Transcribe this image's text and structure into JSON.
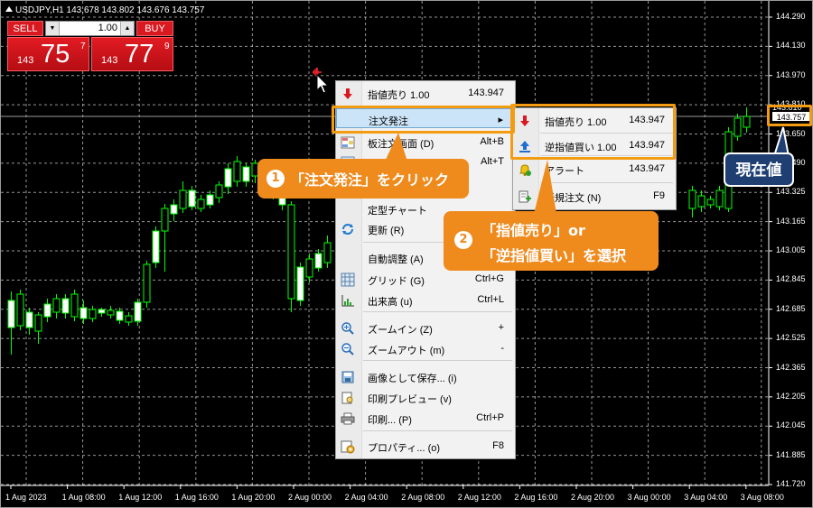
{
  "chart": {
    "symbol_info": "USDJPY,H1  143.678 143.802 143.676 143.757",
    "current_price_hidden": "143.810",
    "current_price": "143.757",
    "y_axis_labels": [
      "144.290",
      "144.130",
      "143.970",
      "143.810",
      "143.650",
      "143.490",
      "143.325",
      "143.165",
      "143.005",
      "142.845",
      "142.685",
      "142.525",
      "142.365",
      "142.205",
      "142.045",
      "141.885",
      "141.720"
    ],
    "x_axis_labels": [
      "1 Aug 2023",
      "1 Aug 08:00",
      "1 Aug 12:00",
      "1 Aug 16:00",
      "1 Aug 20:00",
      "2 Aug 00:00",
      "2 Aug 04:00",
      "2 Aug 08:00",
      "2 Aug 12:00",
      "2 Aug 16:00",
      "2 Aug 20:00",
      "3 Aug 00:00",
      "3 Aug 04:00",
      "3 Aug 08:00"
    ],
    "colors": {
      "background": "#000000",
      "bull_candle": "#ffffff",
      "bear_candle": "#000000",
      "wick": "#00ff00",
      "grid": "#c8c8c8"
    }
  },
  "one_click": {
    "sell_label": "SELL",
    "buy_label": "BUY",
    "lot": "1.00",
    "down_arrow": "▼",
    "up_arrow": "▲",
    "bid_prefix": "143",
    "bid_big": "75",
    "bid_sup": "7",
    "ask_prefix": "143",
    "ask_big": "77",
    "ask_sup": "9"
  },
  "context_menu": {
    "items": [
      {
        "label": "指値売り 1.00",
        "shortcut": "143.947",
        "icon": "sell-limit-arrow-icon"
      },
      {
        "label": "注文発注",
        "shortcut": "▸",
        "icon": "none"
      },
      {
        "label": "板注文画面 (D)",
        "shortcut": "Alt+B",
        "icon": "depth-of-market-icon"
      },
      {
        "label": "",
        "shortcut": "Alt+T",
        "icon": "trade-icon"
      },
      {
        "label": "定型チャート",
        "shortcut": "",
        "icon": "none"
      },
      {
        "label": "更新 (R)",
        "shortcut": "",
        "icon": "refresh-icon"
      },
      {
        "label": "自動調整 (A)",
        "shortcut": "",
        "icon": "none"
      },
      {
        "label": "グリッド (G)",
        "shortcut": "Ctrl+G",
        "icon": "grid-icon"
      },
      {
        "label": "出来高 (u)",
        "shortcut": "Ctrl+L",
        "icon": "volume-icon"
      },
      {
        "label": "ズームイン (Z)",
        "shortcut": "+",
        "icon": "zoom-in-icon"
      },
      {
        "label": "ズームアウト (m)",
        "shortcut": "-",
        "icon": "zoom-out-icon"
      },
      {
        "label": "画像として保存... (i)",
        "shortcut": "",
        "icon": "save-image-icon"
      },
      {
        "label": "印刷プレビュー (v)",
        "shortcut": "",
        "icon": "print-preview-icon"
      },
      {
        "label": "印刷... (P)",
        "shortcut": "Ctrl+P",
        "icon": "printer-icon"
      },
      {
        "label": "プロパティ... (o)",
        "shortcut": "F8",
        "icon": "properties-icon"
      }
    ]
  },
  "submenu": {
    "items": [
      {
        "label": "指値売り 1.00",
        "shortcut": "143.947",
        "icon": "sell-limit-icon"
      },
      {
        "label": "逆指値買い 1.00",
        "shortcut": "143.947",
        "icon": "buy-stop-icon"
      },
      {
        "label": "アラート",
        "shortcut": "143.947",
        "icon": "alert-bell-icon"
      },
      {
        "label": "新規注文 (N)",
        "shortcut": "F9",
        "icon": "new-order-icon"
      }
    ]
  },
  "annotations": {
    "step1_num": "1",
    "step1_text": "「注文発注」をクリック",
    "step2_num": "2",
    "step2_line1": "「指値売り」or",
    "step2_line2": "「逆指値買い」を選択",
    "current_price_label": "現在値",
    "accent_color": "#ef8a1d",
    "blue_color": "#1f3f73"
  }
}
